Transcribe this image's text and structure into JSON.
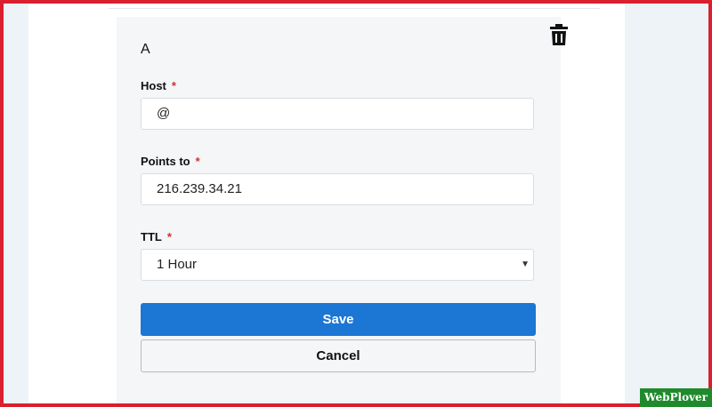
{
  "record": {
    "type_label": "A",
    "host": {
      "label": "Host",
      "required_mark": "*",
      "value": "@"
    },
    "points_to": {
      "label": "Points to",
      "required_mark": "*",
      "value": "216.239.34.21"
    },
    "ttl": {
      "label": "TTL",
      "required_mark": "*",
      "selected": "1 Hour",
      "arrow": "▼"
    }
  },
  "actions": {
    "save_label": "Save",
    "cancel_label": "Cancel"
  },
  "icons": {
    "delete": "trash-icon"
  },
  "watermark": {
    "text": "WebPlover"
  },
  "colors": {
    "primary": "#1c76d4",
    "required": "#d0312d",
    "frame": "#d8202f",
    "watermark_bg": "#1f8a2c"
  }
}
